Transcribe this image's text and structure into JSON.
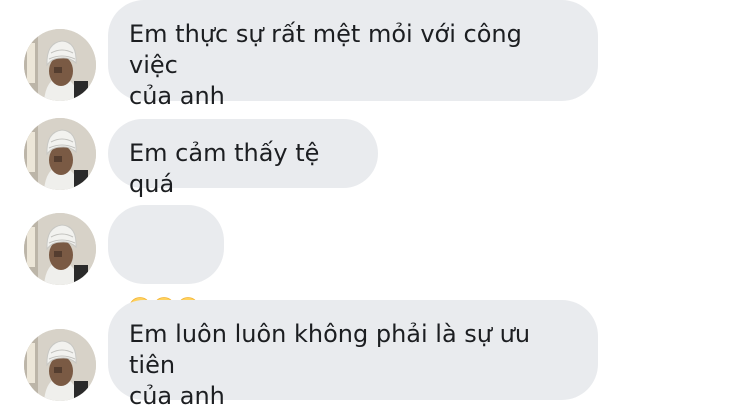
{
  "messages": [
    {
      "type": "text",
      "text": "Em thực sự rất mệt mỏi với công việc\ncủa anh"
    },
    {
      "type": "text",
      "text": "Em cảm thấy tệ quá"
    },
    {
      "type": "emoji",
      "emojis": [
        "smiling-face-emoji",
        "smiling-face-emoji",
        "smiling-face-emoji"
      ]
    },
    {
      "type": "text",
      "text": "Em luôn luôn không phải là sự ưu tiên\ncủa anh"
    }
  ],
  "colors": {
    "bubble_bg": "#e9ebee",
    "text": "#1c1e21",
    "emoji_face": "#ffd15c"
  }
}
